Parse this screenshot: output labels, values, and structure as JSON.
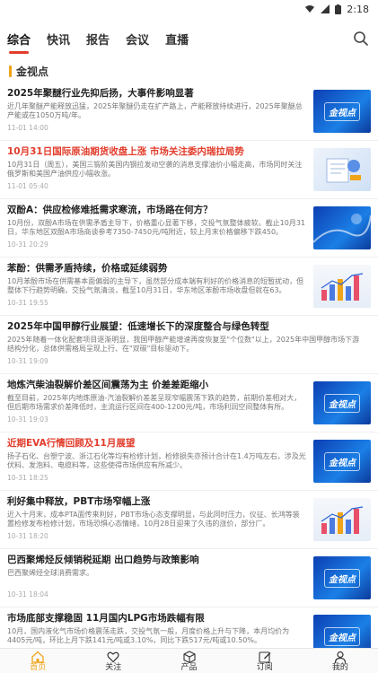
{
  "status": {
    "time": "2:18"
  },
  "tabs": [
    {
      "label": "综合",
      "active": true
    },
    {
      "label": "快讯"
    },
    {
      "label": "报告"
    },
    {
      "label": "会议"
    },
    {
      "label": "直播"
    }
  ],
  "section": {
    "title": "金视点"
  },
  "articles": [
    {
      "title": "2025年聚醚行业先抑后扬，大事件影响显著",
      "summary": "近几年聚醚产能释放迅猛，2025年聚醚仍走在扩产路上，产能释放持续进行，2025年聚醚总产能或在1050万吨/年。",
      "time": "11-01 14:00",
      "thumb": "blue",
      "thumb_text": "金视点",
      "red": false
    },
    {
      "title": "10月31日国际原油期货收盘上涨 市场关注委内瑞拉局势",
      "summary": "10月31日（周五），美国三锻阶美国内钢拉发动空袭的消息支撑油价小幅走高，市场同时关注俄罗斯和美国产油供应小幅收涨。",
      "time": "11-01 05:40",
      "thumb": "light",
      "thumb_text": "",
      "red": true
    },
    {
      "title": "双酚A：供应检修难抵需求寒流，市场路在何方？",
      "summary": "10月份，双酚A市场在供需矛盾主导下，价格重心显著下移，交投气氛整体疲软。截止10月31日，华东地区双酚A市场商谈参考7350-7450元/吨附近，较上月末价格偏移下跌450。",
      "time": "10-31 20:29",
      "thumb": "blue",
      "thumb_text": "",
      "red": false
    },
    {
      "title": "苯酚：供需矛盾持续，价格或延续弱势",
      "summary": "10月苯酚市场在供需基本面偏弱的主导下，虽然部分成本端有利好的价格消息的短暂扰动，但整体下行趋势明确，交投气氛清淡，截至10月31日，华东地区苯酚市场收盘但就在63。",
      "time": "10-31 19:55",
      "thumb": "chart",
      "thumb_text": "",
      "red": false
    },
    {
      "title": "2025年中国甲醇行业展望：低速增长下的深度整合与绿色转型",
      "summary": "2025年随着一体化配套项目逐渐明显，我国甲醇产能增速再度恢复至\"个位数\"以上，2025年中国甲醇市场下游结构分化，总体供需格局呈现上行、在\"双碳\"目标驱动下。",
      "time": "10-31 19:09",
      "thumb": "",
      "thumb_text": "",
      "red": false
    },
    {
      "title": "地炼汽柴油裂解价差区间震荡为主 价差差距缩小",
      "summary": "截至目前，2025年内地炼原油-汽油裂解价差差呈现窄幅震荡下跌的趋势，前期价差相对大，但后期市场需求价差降低时，主流运行区间在400-1200元/吨，市场利润空间整体有所。",
      "time": "10-31 19:03",
      "thumb": "blue",
      "thumb_text": "金视点",
      "red": false
    },
    {
      "title": "近期EVA行情回顾及11月展望",
      "summary": "扬子石化、台塑宁波、浙江石化等均有检修计划，检修损失亦预计合计在1.4万吨左右，涉及光伏料、发泡料、电缆料等，这些使得市场供应有所减少。",
      "time": "10-31 18:25",
      "thumb": "blue",
      "thumb_text": "金视点",
      "red": true
    },
    {
      "title": "利好集中释放，PBT市场窄幅上涨",
      "summary": "近入十月末，成本PTA面传来利好，PBT市场心态支撑明显，与此同时压力，仪征、长鸿等装置检修发布检修计划，市场恐惧心态情绪，10月28日迎来了久违的涨价，部分厂。",
      "time": "10-31 18:20",
      "thumb": "chart",
      "thumb_text": "",
      "red": false
    },
    {
      "title": "巴西聚烯烃反倾销税延期 出口趋势与政策影响",
      "summary": "巴西聚烯烃全球消费需求。",
      "time": "10-31 18:04",
      "thumb": "blue",
      "thumb_text": "金视点",
      "red": false
    },
    {
      "title": "市场底部支撑稳固 11月国内LPG市场跌幅有限",
      "summary": "10月，国内液化气市场价格震荡走跌，交投气氛一般，月度价格上升与下降，本月均价为4405元/吨，环比上月下跌141元/吨或3.10%，同比下跌517元/吨或10.50%。",
      "time": "10-31 18:00",
      "thumb": "blue",
      "thumb_text": "金视点",
      "red": false
    }
  ],
  "bottom_nav": [
    {
      "label": "首页",
      "icon": "home-icon",
      "active": true
    },
    {
      "label": "关注",
      "icon": "heart-icon"
    },
    {
      "label": "产品",
      "icon": "cube-icon"
    },
    {
      "label": "订阅",
      "icon": "edit-icon"
    },
    {
      "label": "我的",
      "icon": "user-icon"
    }
  ],
  "colors": {
    "accent": "#e23c2b",
    "highlight": "#f0a419",
    "thumb_blue": "#1b7fe6"
  }
}
